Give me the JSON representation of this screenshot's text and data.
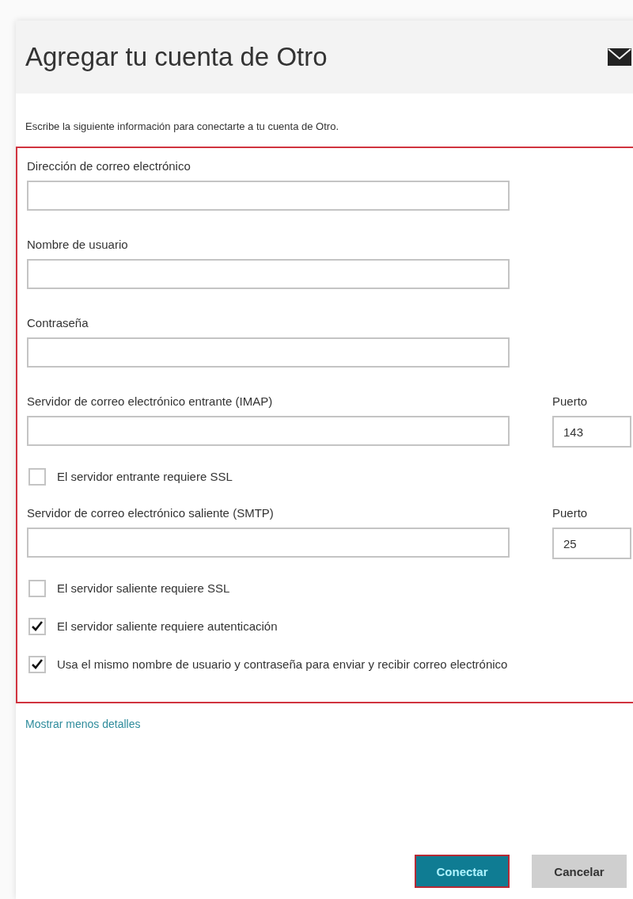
{
  "header": {
    "title": "Agregar tu cuenta de Otro"
  },
  "intro": "Escribe la siguiente información para conectarte a tu cuenta de Otro.",
  "form": {
    "items": [
      {
        "kind": "field",
        "label": "Dirección de correo electrónico"
      },
      {
        "kind": "field",
        "label": "Nombre de usuario"
      },
      {
        "kind": "field",
        "label": "Contraseña"
      },
      {
        "kind": "server",
        "label": "Servidor de correo electrónico entrante (IMAP)",
        "port_label": "Puerto",
        "port_value": "143"
      },
      {
        "kind": "checkbox",
        "label": "El servidor entrante requiere SSL",
        "checked": false
      },
      {
        "kind": "server",
        "label": "Servidor de correo electrónico saliente (SMTP)",
        "port_label": "Puerto",
        "port_value": "25"
      },
      {
        "kind": "checkbox",
        "label": "El servidor saliente requiere SSL",
        "checked": false
      },
      {
        "kind": "checkbox",
        "label": "El servidor saliente requiere autenticación",
        "checked": true
      },
      {
        "kind": "checkbox",
        "label": "Usa el mismo nombre de usuario y contraseña para enviar y recibir correo electrónico",
        "checked": true
      }
    ]
  },
  "details_link": "Mostrar menos detalles",
  "buttons": [
    {
      "label": "Conectar",
      "kind": "primary"
    },
    {
      "label": "Cancelar",
      "kind": "secondary"
    }
  ]
}
